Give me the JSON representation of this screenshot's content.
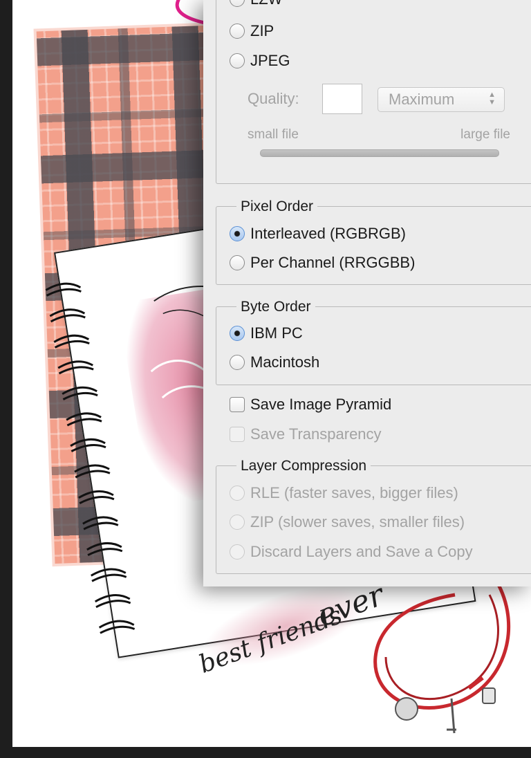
{
  "image_compression": {
    "options": [
      {
        "label": "LZW",
        "selected": false
      },
      {
        "label": "ZIP",
        "selected": false
      },
      {
        "label": "JPEG",
        "selected": false
      }
    ],
    "quality_label": "Quality:",
    "quality_value": "",
    "quality_preset": "Maximum",
    "small_file_label": "small file",
    "large_file_label": "large file"
  },
  "pixel_order": {
    "title": "Pixel Order",
    "options": [
      {
        "label": "Interleaved (RGBRGB)",
        "selected": true
      },
      {
        "label": "Per Channel (RRGGBB)",
        "selected": false
      }
    ]
  },
  "byte_order": {
    "title": "Byte Order",
    "options": [
      {
        "label": "IBM PC",
        "selected": true
      },
      {
        "label": "Macintosh",
        "selected": false
      }
    ]
  },
  "save_image_pyramid": {
    "label": "Save Image Pyramid",
    "checked": false
  },
  "save_transparency": {
    "label": "Save Transparency",
    "checked": false,
    "enabled": false
  },
  "layer_compression": {
    "title": "Layer Compression",
    "enabled": false,
    "options": [
      {
        "label": "RLE (faster saves, bigger files)",
        "selected": false
      },
      {
        "label": "ZIP (slower saves, smaller files)",
        "selected": false
      },
      {
        "label": "Discard Layers and Save a Copy",
        "selected": false
      }
    ]
  },
  "background": {
    "caption_line1": "best friends",
    "caption_line2": "ever"
  },
  "colors": {
    "dialog_bg": "#ececec",
    "annotation_pink": "#e0208c",
    "selected_radio": "#a9c8ef",
    "bracelet_red": "#c8282e"
  }
}
